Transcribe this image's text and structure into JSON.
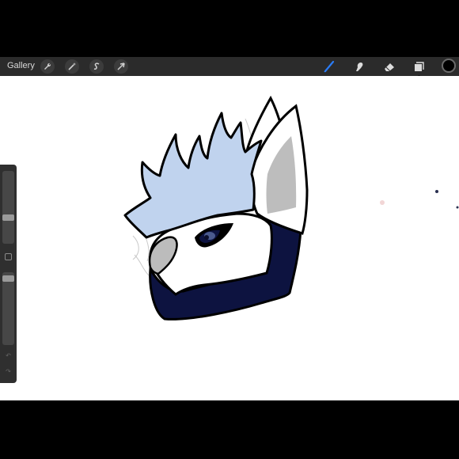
{
  "toolbar": {
    "gallery_label": "Gallery",
    "left_tools": [
      {
        "name": "actions",
        "icon": "wrench-icon"
      },
      {
        "name": "adjustments",
        "icon": "magic-wand-icon"
      },
      {
        "name": "selection",
        "icon": "selection-s-icon"
      },
      {
        "name": "transform",
        "icon": "arrow-cursor-icon"
      }
    ],
    "right_tools": [
      {
        "name": "brush",
        "icon": "brush-icon",
        "active": true
      },
      {
        "name": "smudge",
        "icon": "smudge-hand-icon"
      },
      {
        "name": "eraser",
        "icon": "eraser-icon"
      },
      {
        "name": "layers",
        "icon": "layers-icon"
      }
    ],
    "current_color": "#000000",
    "active_tool_color": "#2a7cf6"
  },
  "sidebar": {
    "brush_size_level": 0.35,
    "opacity_level": 0.05
  },
  "artwork": {
    "description_colors": {
      "hair": "#c0d3ee",
      "mask": "#0d1340",
      "ear_inner": "#bdbdbd",
      "outline": "#000000"
    }
  }
}
